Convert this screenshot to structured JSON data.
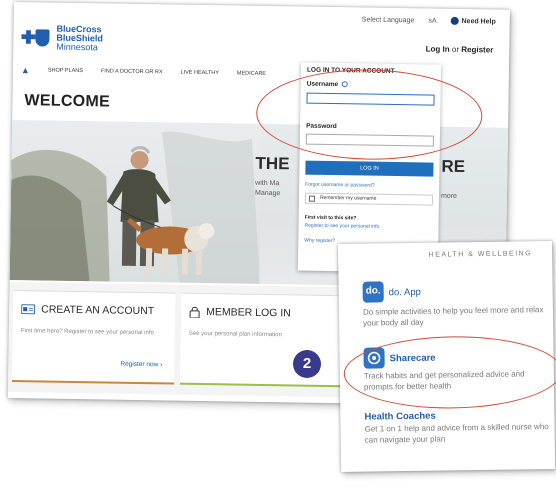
{
  "utility": {
    "language": "Select Language",
    "font_size": "sA",
    "help": "Need Help"
  },
  "brand": {
    "name_line1": "BlueCross",
    "name_line2": "BlueShield",
    "state": "Minnesota"
  },
  "header": {
    "login_link": "Log In",
    "or": "or",
    "register_link": "Register"
  },
  "nav": {
    "items": [
      "SHOP PLANS",
      "FIND A DOCTOR OR RX",
      "LIVE HEALTHY",
      "MEDICARE"
    ]
  },
  "page": {
    "welcome": "WELCOME"
  },
  "hero": {
    "headline_start": "THE",
    "headline_end": "RE",
    "sub_line1": "with Ma",
    "sub_line2": "Manage",
    "more": "more"
  },
  "cards": {
    "create_title": "CREATE AN ACCOUNT",
    "create_desc": "First time here? Register to see your personal info",
    "create_cta": "Register now",
    "member_title": "MEMBER LOG IN",
    "member_desc": "See your personal plan information"
  },
  "login_panel": {
    "title": "LOG IN TO YOUR ACCOUNT",
    "username_label": "Username",
    "password_label": "Password",
    "login_button": "LOG IN",
    "forgot": "Forgot username or password?",
    "remember": "Remember my username",
    "first_visit": "First visit to this site?",
    "register_prompt": "Register to see your personal info",
    "why_register": "Why register?"
  },
  "step_badge": "2",
  "health_wellbeing": {
    "title": "HEALTH & WELLBEING",
    "items": [
      {
        "logo": "do.",
        "name": "do. App",
        "desc": "Do simple activities to help you feel more and relax your body all day"
      },
      {
        "logo": "",
        "name": "Sharecare",
        "desc": "Track habits and get personalized advice and prompts for better health"
      },
      {
        "logo": "",
        "name": "Health Coaches",
        "desc": "Get 1 on 1 help and advice from a skilled nurse who can navigate your plan"
      }
    ]
  },
  "colors": {
    "brand_blue": "#1f5fae",
    "login_button": "#1f6fbd",
    "annotation_red": "#d24a37",
    "step_badge": "#3a3a8c"
  }
}
